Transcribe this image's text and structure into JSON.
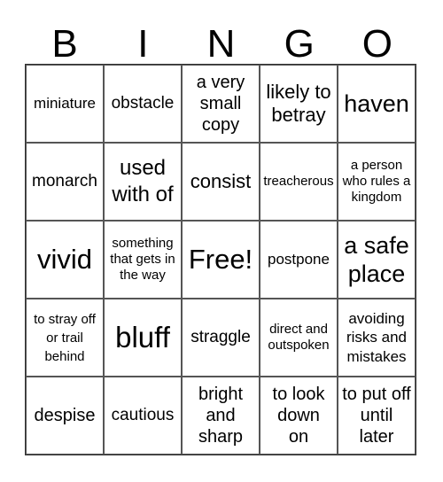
{
  "header": [
    "B",
    "I",
    "N",
    "G",
    "O"
  ],
  "cells": [
    "miniature",
    "obstacle",
    "a very small copy",
    "likely to betray",
    "haven",
    "monarch",
    "used with of",
    "consist",
    "treacherous",
    "a person who rules a kingdom",
    "vivid",
    "something that gets in the way",
    "Free!",
    "postpone",
    "a safe place",
    "to stray off or trail behind",
    "bluff",
    "straggle",
    "direct and outspoken",
    "avoiding risks and mistakes",
    "despise",
    "cautious",
    "bright and sharp",
    "to look down on",
    "to put off until later"
  ]
}
